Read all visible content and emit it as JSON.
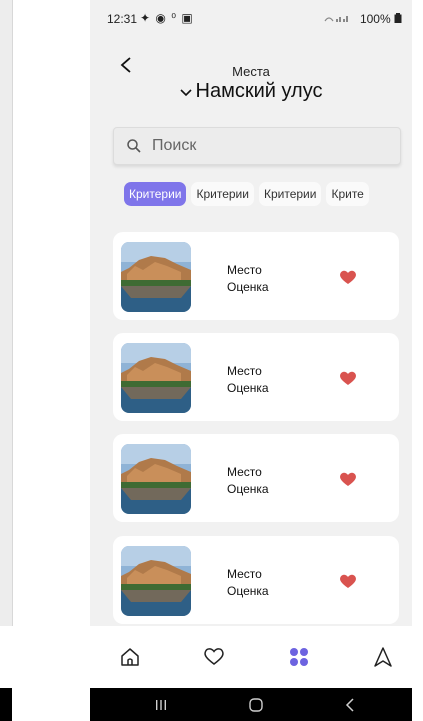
{
  "status_bar": {
    "time": "12:31",
    "icons": "✦ ◉ ⁰ ▣",
    "battery": "100%"
  },
  "header": {
    "back_icon": "chevron-left-icon",
    "subtitle": "Места",
    "title": "Намский улус"
  },
  "search": {
    "placeholder": "Поиск",
    "value": ""
  },
  "chips": [
    "Критерии",
    "Критерии",
    "Критерии",
    "Крите"
  ],
  "places": [
    {
      "name": "Место",
      "rating": "Оценка"
    },
    {
      "name": "Место",
      "rating": "Оценка"
    },
    {
      "name": "Место",
      "rating": "Оценка"
    },
    {
      "name": "Место",
      "rating": "Оценка"
    }
  ],
  "bottom_nav": [
    "home-icon",
    "heart-outline-icon",
    "grid-dots-icon",
    "navigation-arrow-icon"
  ],
  "colors": {
    "accent": "#7f75ea",
    "heart": "#d9534f",
    "background": "#f1f1f1",
    "card": "#ffffff"
  }
}
